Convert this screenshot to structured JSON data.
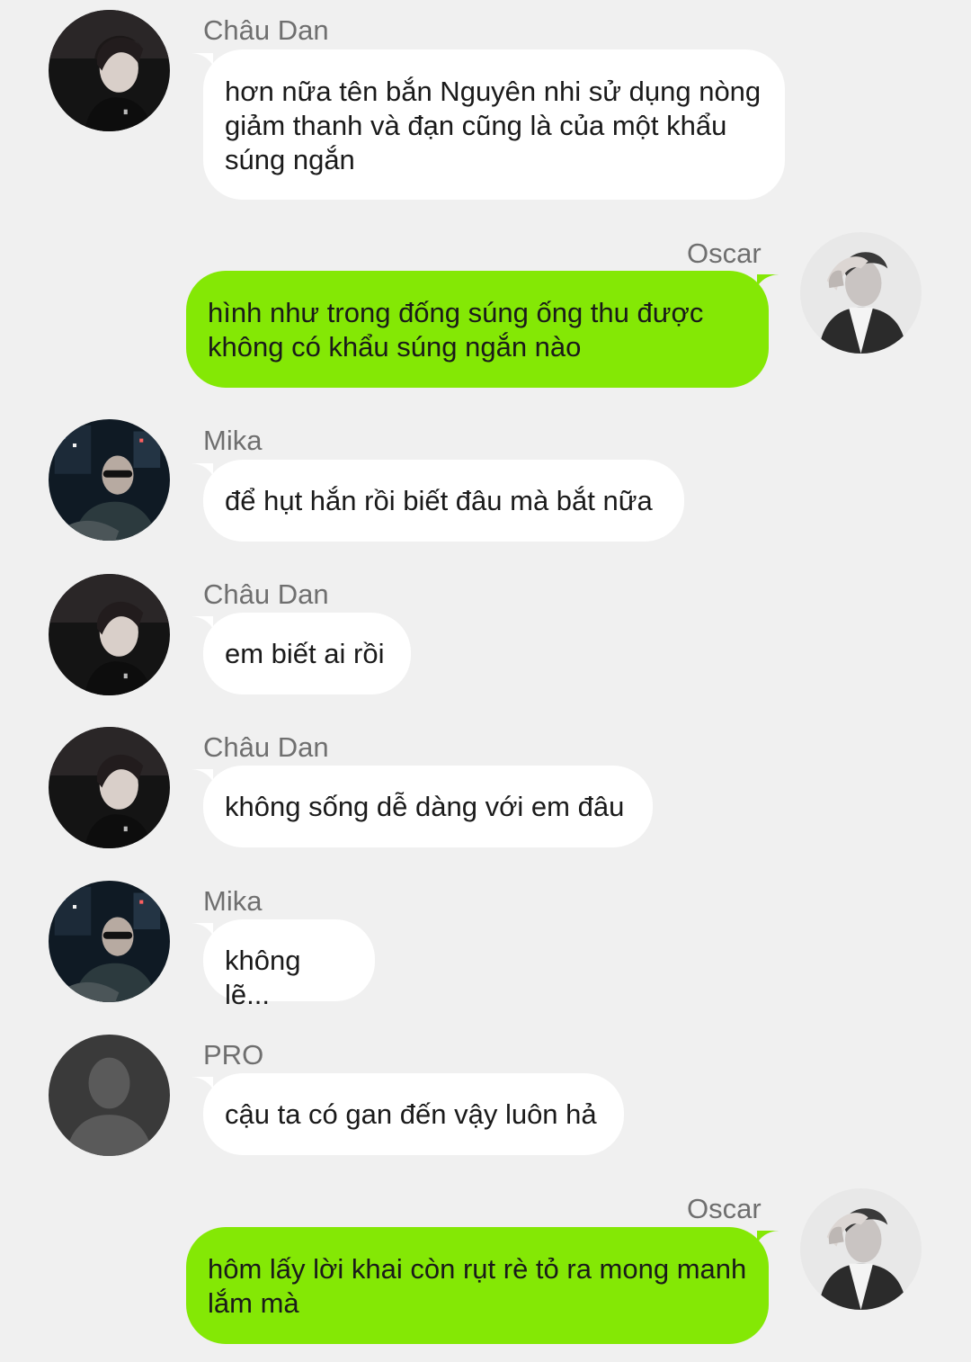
{
  "colors": {
    "background": "#f0f0f0",
    "incoming_bubble": "#ffffff",
    "outgoing_bubble": "#84e805",
    "name_text": "#6f6f6f",
    "message_text": "#1a1a1a"
  },
  "messages": [
    {
      "sender": "Châu Dan",
      "avatar": "chau-dan-avatar",
      "direction": "incoming",
      "text": "hơn nữa tên bắn Nguyên nhi sử dụng nòng giảm thanh và đạn cũng là của một khẩu súng ngắn"
    },
    {
      "sender": "Oscar",
      "avatar": "oscar-avatar",
      "direction": "outgoing",
      "text": "hình như trong đống súng ống thu được không có khẩu súng ngắn nào"
    },
    {
      "sender": "Mika",
      "avatar": "mika-avatar",
      "direction": "incoming",
      "text": "để hụt hắn rồi biết đâu mà bắt nữa"
    },
    {
      "sender": "Châu Dan",
      "avatar": "chau-dan-avatar",
      "direction": "incoming",
      "text": "em biết ai rồi"
    },
    {
      "sender": "Châu Dan",
      "avatar": "chau-dan-avatar",
      "direction": "incoming",
      "text": "không sống dễ dàng với em đâu"
    },
    {
      "sender": "Mika",
      "avatar": "mika-avatar",
      "direction": "incoming",
      "text": "không lẽ..."
    },
    {
      "sender": "PRO",
      "avatar": "default-user-avatar",
      "direction": "incoming",
      "text": "cậu ta có gan đến vậy luôn hả"
    },
    {
      "sender": "Oscar",
      "avatar": "oscar-avatar",
      "direction": "outgoing",
      "text": "hôm lấy lời khai còn rụt rè tỏ ra mong manh lắm mà"
    }
  ]
}
